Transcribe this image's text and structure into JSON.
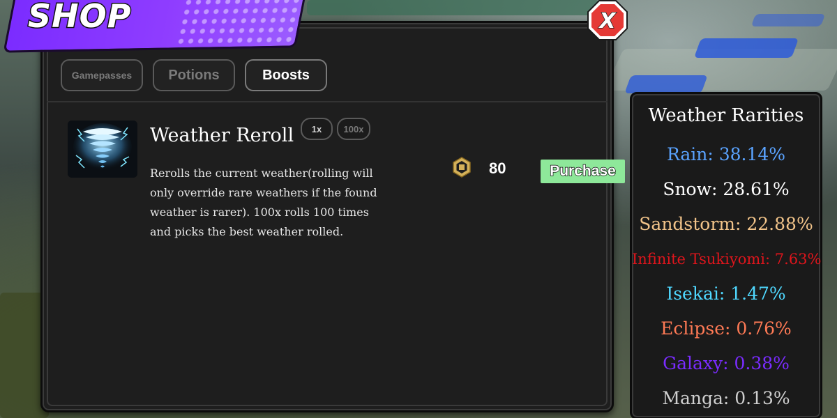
{
  "shop": {
    "title": "SHOP",
    "close_label": "X",
    "tabs": [
      {
        "label": "Gamepasses",
        "active": false
      },
      {
        "label": "Potions",
        "active": false
      },
      {
        "label": "Boosts",
        "active": true
      }
    ]
  },
  "item": {
    "name": "Weather Reroll",
    "icon": "tornado-icon",
    "quantity_options": [
      "1x",
      "100x"
    ],
    "selected_quantity": "1x",
    "description": "Rerolls the current weather(rolling will only override rare weathers if the found weather is rarer). 100x rolls 100 times and picks the best weather rolled.",
    "price": "80",
    "currency_icon": "robux-icon",
    "purchase_label": "Purchase"
  },
  "rarities": {
    "title": "Weather Rarities",
    "items": [
      {
        "label": "Rain: 38.14%",
        "color": "#5aa3ff"
      },
      {
        "label": "Snow: 28.61%",
        "color": "#ffffff"
      },
      {
        "label": "Sandstorm: 22.88%",
        "color": "#f2c48a"
      },
      {
        "label": "Infinite Tsukiyomi: 7.63%",
        "color": "#e0151c"
      },
      {
        "label": "Isekai: 1.47%",
        "color": "#4fd8ff"
      },
      {
        "label": "Eclipse: 0.76%",
        "color": "#ff7a55"
      },
      {
        "label": "Galaxy: 0.38%",
        "color": "#7a2cff"
      },
      {
        "label": "Manga: 0.13%",
        "color": "#cfcfcf"
      }
    ]
  },
  "colors": {
    "banner": "#8f3dff",
    "purchase_button": "#8ee89a",
    "close_button": "#e53935"
  }
}
